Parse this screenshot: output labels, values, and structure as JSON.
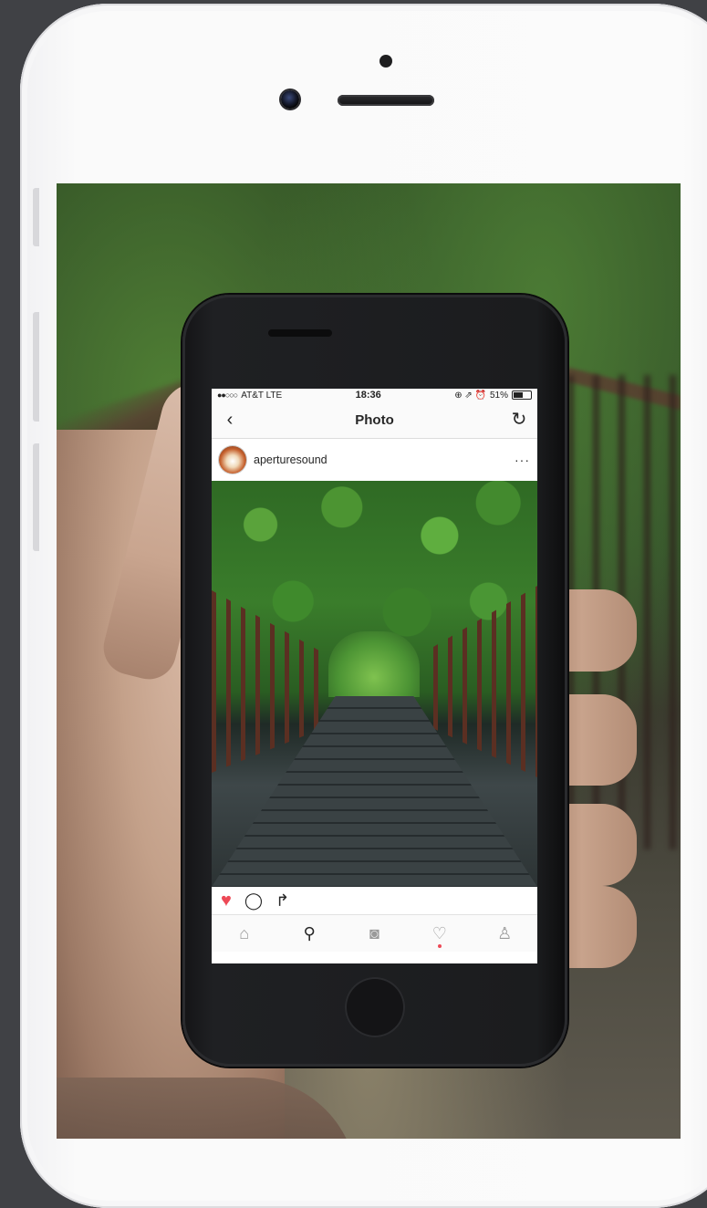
{
  "status_bar": {
    "signal": "●●○○○",
    "carrier": "AT&T  LTE",
    "time": "18:36",
    "indicators": "⊕ ⇗ ⏰",
    "battery_percent": "51%"
  },
  "nav": {
    "back_icon": "chevron-left-icon",
    "title": "Photo",
    "refresh_icon": "refresh-icon"
  },
  "post": {
    "username": "aperturesound",
    "more_label": "···",
    "liked": true
  },
  "actions": {
    "like_glyph": "♥",
    "comment_glyph": "◯",
    "share_glyph": "↱"
  },
  "tabbar": {
    "items": [
      {
        "name": "home",
        "glyph": "⌂"
      },
      {
        "name": "search",
        "glyph": "⚲"
      },
      {
        "name": "camera",
        "glyph": "◙"
      },
      {
        "name": "activity",
        "glyph": "♡"
      },
      {
        "name": "profile",
        "glyph": "♙"
      }
    ],
    "active": "search"
  },
  "colors": {
    "like_red": "#ed4956",
    "text": "#262626",
    "outer_bg": "#404145"
  }
}
